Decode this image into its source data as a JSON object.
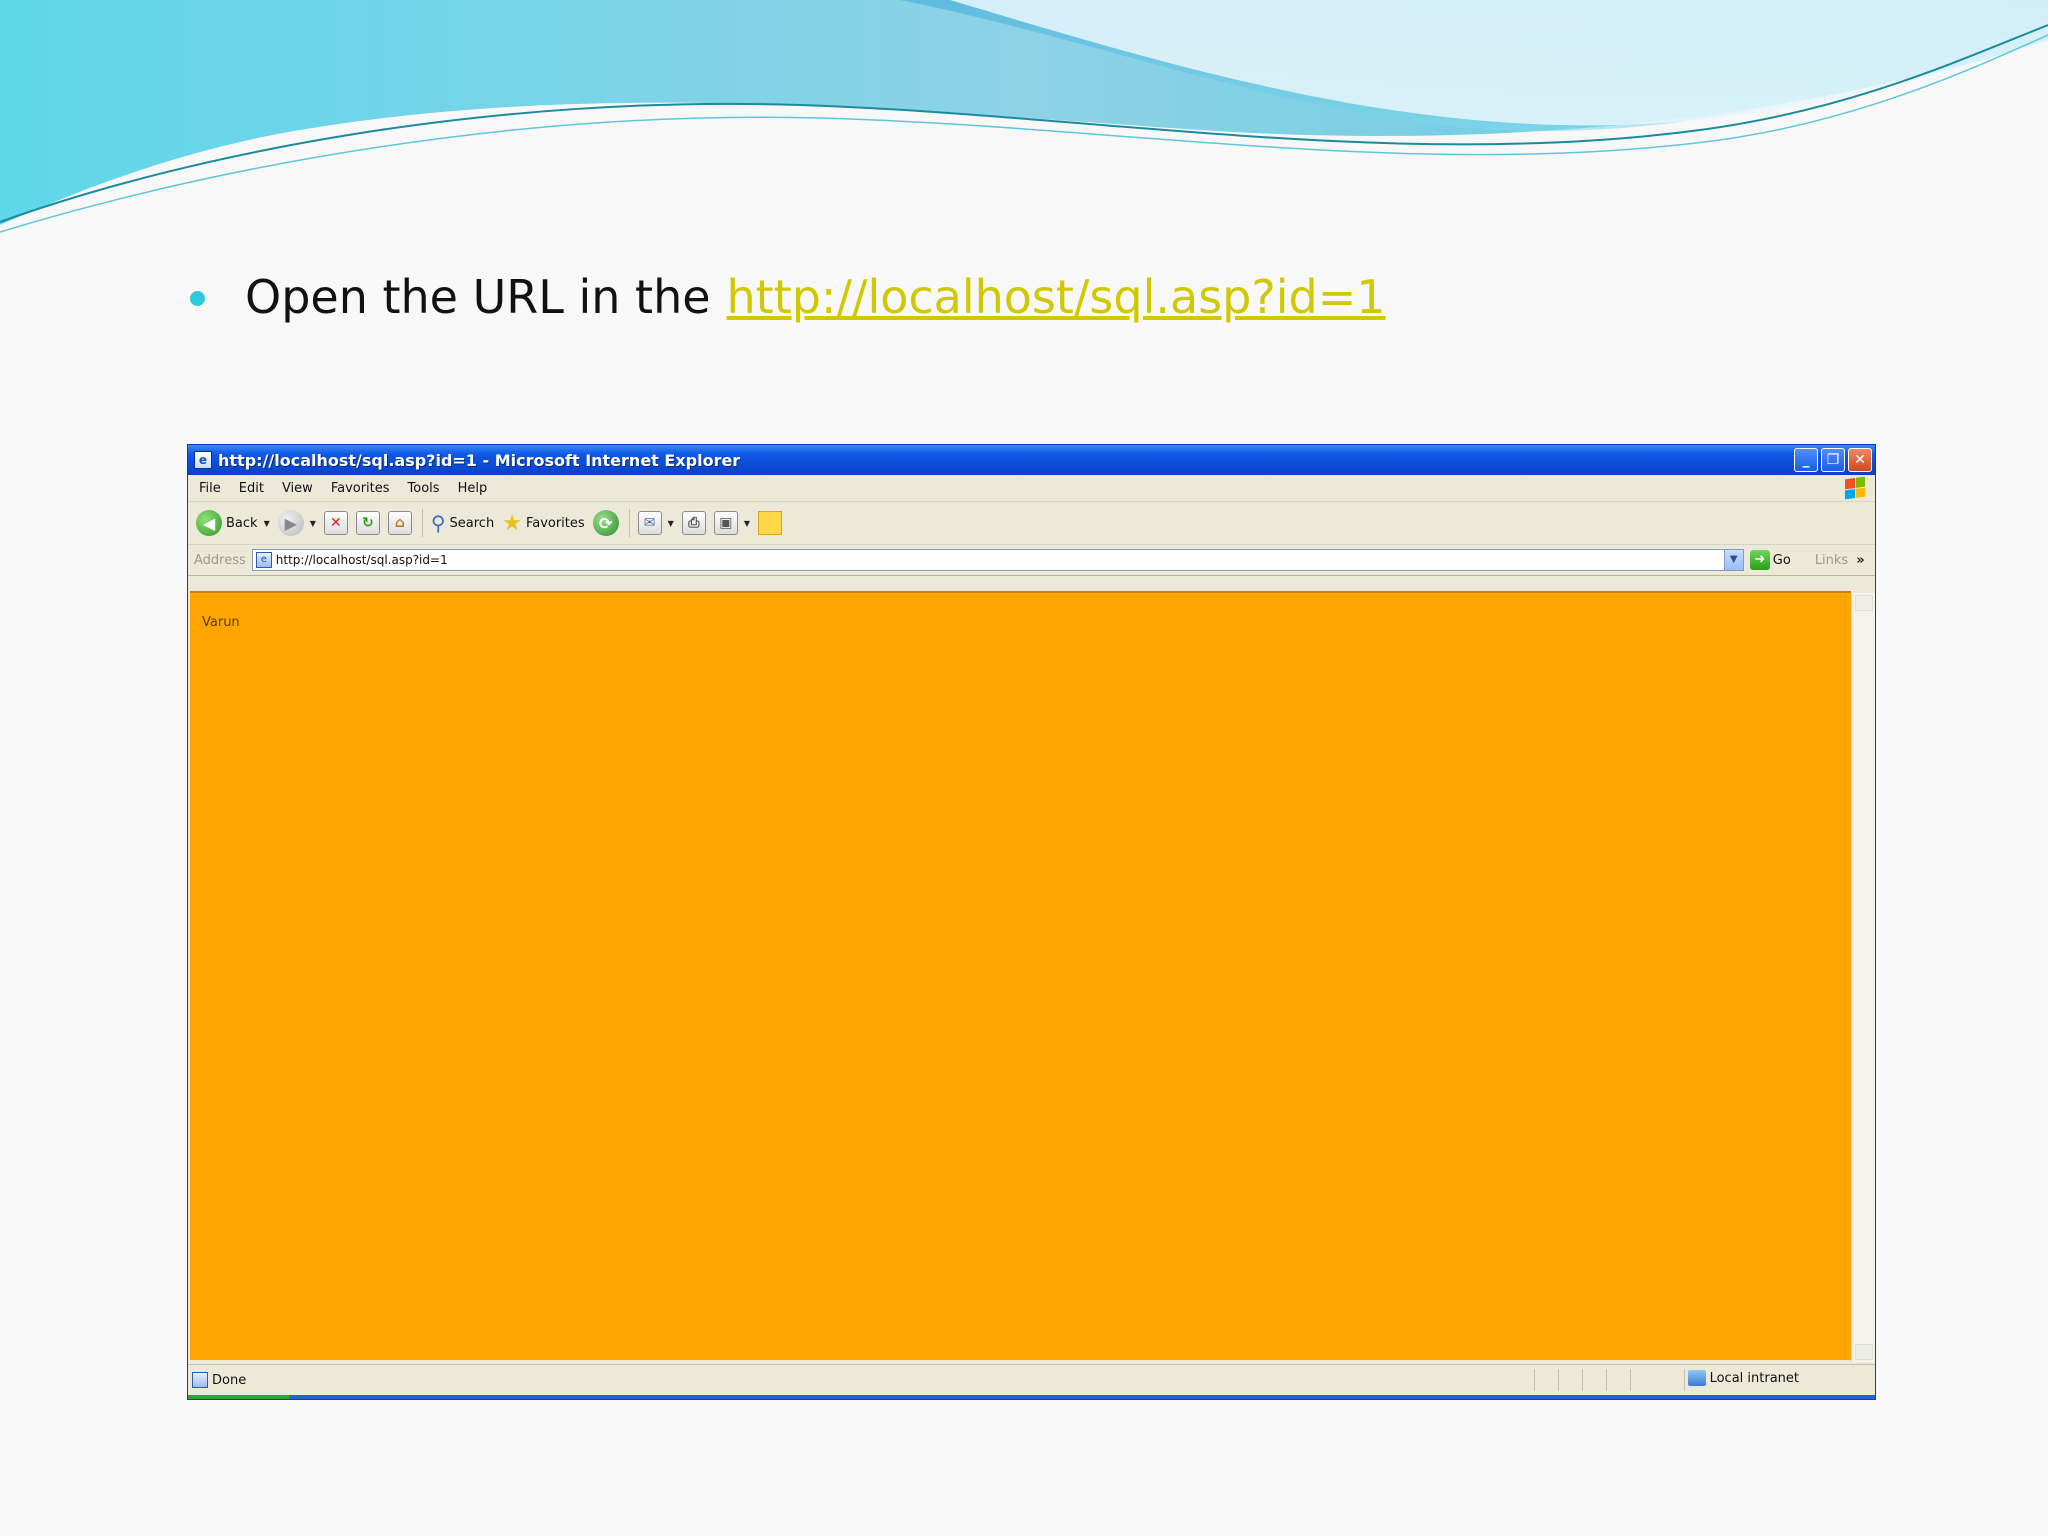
{
  "slide": {
    "bullet_text": "Open the URL in the",
    "bullet_link": "http://localhost/sql.asp?id=1",
    "accent_color": "#2ec8de",
    "link_color": "#d0c800"
  },
  "browser": {
    "title": "http://localhost/sql.asp?id=1 - Microsoft Internet Explorer",
    "menu": [
      "File",
      "Edit",
      "View",
      "Favorites",
      "Tools",
      "Help"
    ],
    "toolbar": {
      "back_label": "Back",
      "search_label": "Search",
      "favorites_label": "Favorites"
    },
    "address": {
      "label": "Address",
      "value": "http://localhost/sql.asp?id=1",
      "go_label": "Go",
      "links_label": "Links"
    },
    "page": {
      "text": "Varun",
      "background": "#ffa500"
    },
    "status": {
      "text": "Done",
      "zone": "Local intranet"
    }
  }
}
